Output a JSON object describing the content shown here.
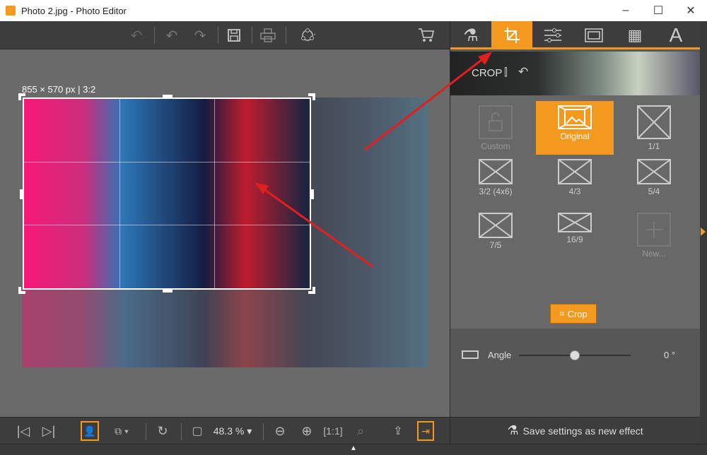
{
  "window": {
    "title": "Photo 2.jpg - Photo Editor",
    "minimize": "–",
    "maximize": "☐",
    "close": "✕"
  },
  "toolbar": {
    "icons": [
      "redo-icon",
      "undo-icon",
      "redo-icon",
      "save-icon",
      "print-icon",
      "share-icon",
      "cart-icon"
    ]
  },
  "canvas": {
    "dimensions_label": "855 × 570 px | 3:2"
  },
  "panel": {
    "tabs": [
      "effects-flask-icon",
      "crop-icon",
      "adjust-sliders-icon",
      "frame-icon",
      "texture-icon",
      "text-icon"
    ],
    "active_tab": "crop",
    "section_title": "CROP",
    "presets": [
      {
        "label": "Custom",
        "icon": "unlock-icon",
        "state": "disabled"
      },
      {
        "label": "Original",
        "icon": "image-icon",
        "state": "selected"
      },
      {
        "label": "1/1",
        "icon": "cross-box-icon",
        "state": "normal"
      },
      {
        "label": "3/2 (4x6)",
        "icon": "cross-box-icon",
        "state": "normal"
      },
      {
        "label": "4/3",
        "icon": "cross-box-icon",
        "state": "normal"
      },
      {
        "label": "5/4",
        "icon": "cross-box-icon",
        "state": "normal"
      },
      {
        "label": "7/5",
        "icon": "cross-box-icon",
        "state": "normal"
      },
      {
        "label": "16/9",
        "icon": "cross-box-icon",
        "state": "normal"
      },
      {
        "label": "New...",
        "icon": "plus-icon",
        "state": "disabled"
      }
    ],
    "angle": {
      "label": "Angle",
      "value": "0 °",
      "slider_fraction": 0.5
    },
    "crop_button": "Crop",
    "save_effect": "Save settings as new effect"
  },
  "bottombar": {
    "zoom": "48.3 %"
  },
  "colors": {
    "accent": "#f39a1e",
    "toolbar": "#3d3d3d",
    "canvas": "#6a6a6a",
    "annotation": "#e02020"
  }
}
